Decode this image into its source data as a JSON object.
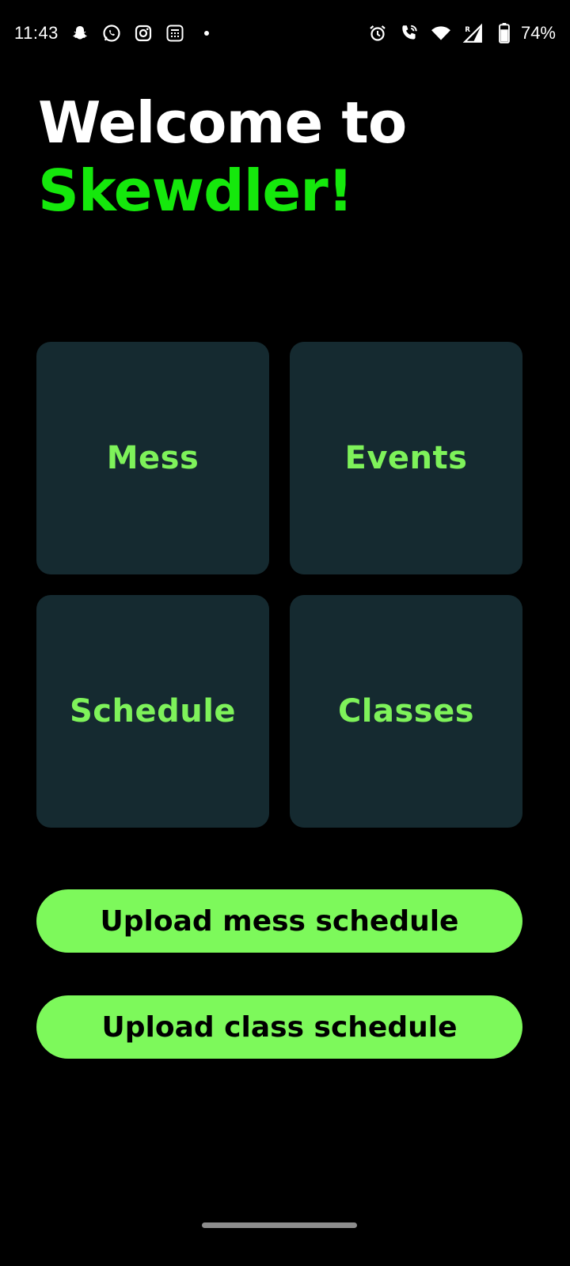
{
  "status_bar": {
    "time": "11:43",
    "left_icons": [
      "snapchat-icon",
      "whatsapp-icon",
      "instagram-icon",
      "calculator-app-icon",
      "notification-dot"
    ],
    "right_icons": [
      "alarm-icon",
      "wifi-calling-icon",
      "wifi-icon",
      "signal-roaming-icon",
      "battery-icon"
    ],
    "battery_percent": "74%"
  },
  "header": {
    "title_line1": "Welcome to",
    "title_line2": "Skewdler!"
  },
  "tiles": [
    {
      "label": "Mess"
    },
    {
      "label": "Events"
    },
    {
      "label": "Schedule"
    },
    {
      "label": "Classes"
    }
  ],
  "buttons": {
    "upload_mess": "Upload mess schedule",
    "upload_class": "Upload class schedule"
  },
  "colors": {
    "background": "#000000",
    "title_white": "#ffffff",
    "title_green": "#15e80c",
    "tile_bg": "#152a30",
    "tile_text": "#7ef25a",
    "button_bg": "#7df95b",
    "button_text": "#000000"
  }
}
